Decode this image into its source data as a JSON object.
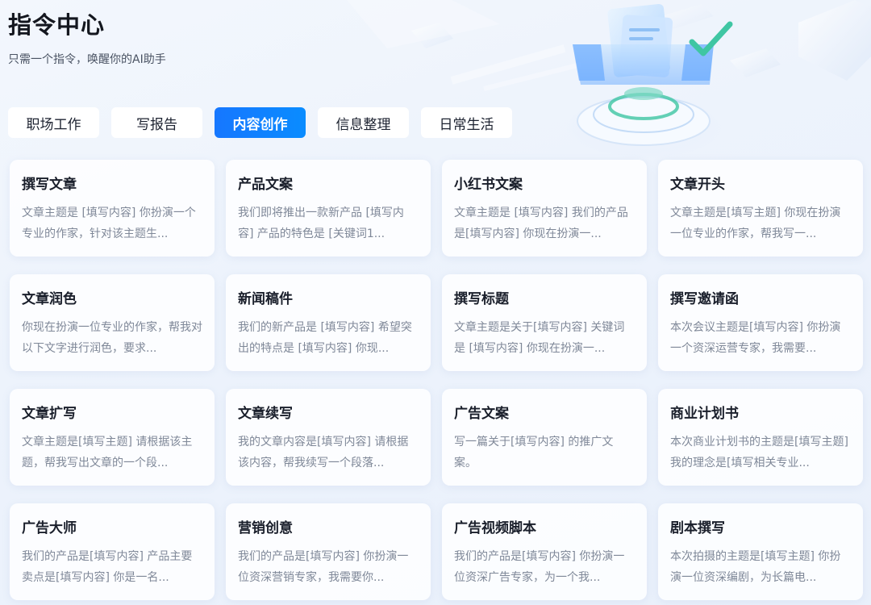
{
  "header": {
    "title": "指令中心",
    "subtitle": "只需一个指令，唤醒你的AI助手"
  },
  "tabs": [
    {
      "label": "职场工作",
      "active": false
    },
    {
      "label": "写报告",
      "active": false
    },
    {
      "label": "内容创作",
      "active": true
    },
    {
      "label": "信息整理",
      "active": false
    },
    {
      "label": "日常生活",
      "active": false
    }
  ],
  "cards": [
    {
      "title": "撰写文章",
      "desc": "文章主题是 [填写内容] 你扮演一个专业的作家，针对该主题生..."
    },
    {
      "title": "产品文案",
      "desc": "我们即将推出一款新产品 [填写内容] 产品的特色是 [关键词1..."
    },
    {
      "title": "小红书文案",
      "desc": "文章主题是 [填写内容] 我们的产品是[填写内容] 你现在扮演一..."
    },
    {
      "title": "文章开头",
      "desc": "文章主题是[填写主题] 你现在扮演一位专业的作家，帮我写一..."
    },
    {
      "title": "文章润色",
      "desc": "你现在扮演一位专业的作家，帮我对以下文字进行润色，要求..."
    },
    {
      "title": "新闻稿件",
      "desc": "我们的新产品是 [填写内容] 希望突出的特点是 [填写内容] 你现..."
    },
    {
      "title": "撰写标题",
      "desc": "文章主题是关于[填写内容] 关键词是 [填写内容] 你现在扮演一..."
    },
    {
      "title": "撰写邀请函",
      "desc": "本次会议主题是[填写内容] 你扮演一个资深运营专家，我需要..."
    },
    {
      "title": "文章扩写",
      "desc": "文章主题是[填写主题] 请根据该主题，帮我写出文章的一个段..."
    },
    {
      "title": "文章续写",
      "desc": "我的文章内容是[填写内容] 请根据该内容，帮我续写一个段落..."
    },
    {
      "title": "广告文案",
      "desc": "写一篇关于[填写内容] 的推广文案。"
    },
    {
      "title": "商业计划书",
      "desc": "本次商业计划书的主题是[填写主题] 我的理念是[填写相关专业..."
    },
    {
      "title": "广告大师",
      "desc": "我们的产品是[填写内容] 产品主要卖点是[填写内容] 你是一名..."
    },
    {
      "title": "营销创意",
      "desc": "我们的产品是[填写内容] 你扮演一位资深营销专家，我需要你..."
    },
    {
      "title": "广告视频脚本",
      "desc": "我们的产品是[填写内容] 你扮演一位资深广告专家，为一个我..."
    },
    {
      "title": "剧本撰写",
      "desc": "本次拍摄的主题是[填写主题] 你扮演一位资深编剧，为长篇电..."
    }
  ],
  "colors": {
    "accent": "#1677ff",
    "title": "#14171f",
    "desc": "#7f8898"
  },
  "icons": {
    "hero": "document-checkmark-illustration"
  }
}
